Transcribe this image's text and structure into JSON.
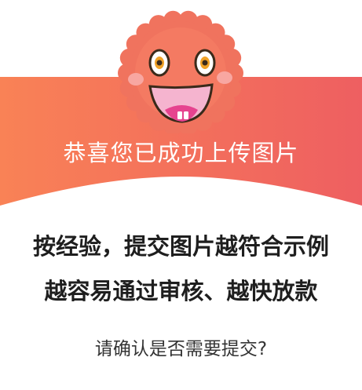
{
  "dialog": {
    "banner_text": "恭喜您已成功上传图片",
    "headline_line1": "按经验，提交图片越符合示例",
    "headline_line2": "越容易通过审核、越快放款",
    "question": "请确认是否需要提交?"
  },
  "mascot": {
    "icon": "smiling-sun-mascot-icon",
    "color": "#F0735E"
  },
  "colors": {
    "banner_gradient_start": "#F98256",
    "banner_gradient_end": "#EE5F61",
    "headline_text": "#1E1E1E",
    "question_text": "#333333"
  }
}
